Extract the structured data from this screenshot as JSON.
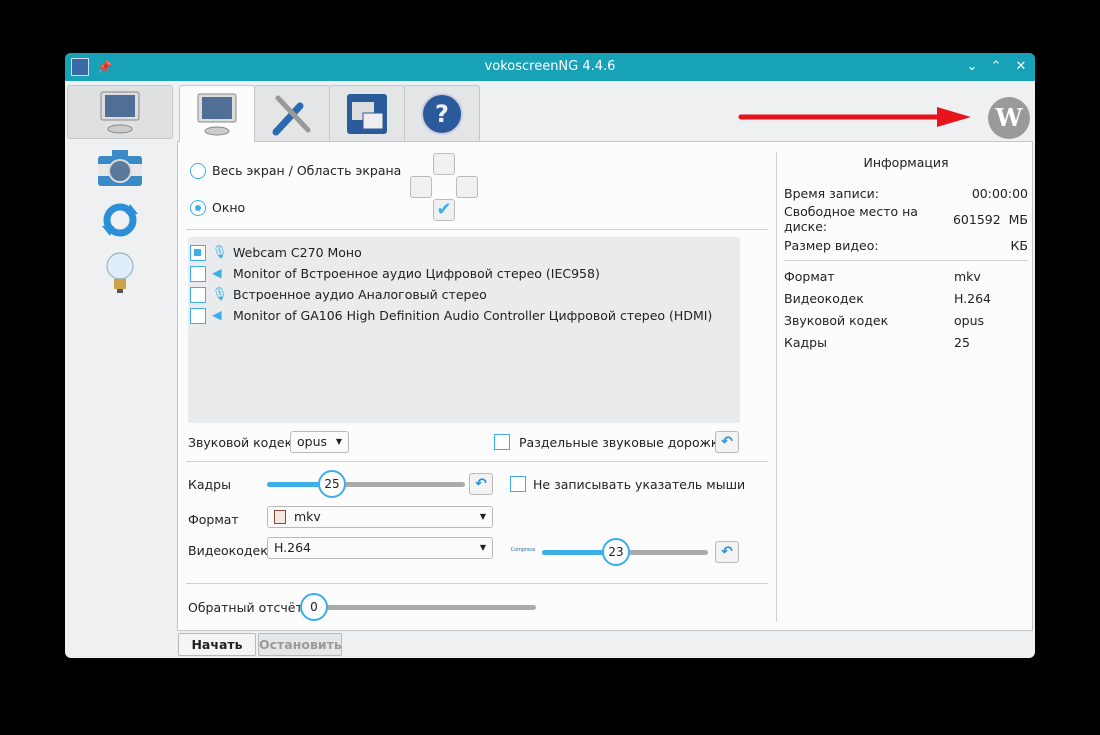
{
  "window": {
    "title": "vokoscreenNG 4.4.6"
  },
  "screen": {
    "mode_fullscreen": "Весь экран / Область экрана",
    "mode_window": "Окно",
    "selected_mode": "window",
    "audio_devices": [
      {
        "label": "Webcam C270 Моно",
        "type": "microphone",
        "checked": true
      },
      {
        "label": "Monitor of Встроенное аудио Цифровой стерео (IEC958)",
        "type": "speaker",
        "checked": false
      },
      {
        "label": "Встроенное аудио Аналоговый стерео",
        "type": "microphone",
        "checked": false
      },
      {
        "label": "Monitor of GA106 High Definition Audio Controller Цифровой стерео (HDMI)",
        "type": "speaker",
        "checked": false
      }
    ],
    "audio_codec_label": "Звуковой кодек",
    "audio_codec_value": "opus",
    "separate_tracks_label": "Раздельные звуковые дорожки",
    "frames_label": "Кадры",
    "frames_value": "25",
    "frames_fraction": 0.33,
    "no_cursor_label": "Не записывать указатель мыши",
    "format_label": "Формат",
    "format_value": "mkv",
    "videocodec_label": "Видеокодек",
    "videocodec_value": "H.264",
    "compress_icon_text": "Compress",
    "quality_value": "23",
    "quality_fraction": 0.45,
    "countdown_label": "Обратный отсчёт",
    "countdown_value": "0"
  },
  "info": {
    "title": "Информация",
    "rows1": [
      [
        "Время записи:",
        "00:00:00"
      ],
      [
        "Свободное место на диске:",
        "601592  МБ"
      ],
      [
        "Размер видео:",
        "КБ"
      ]
    ],
    "rows2": [
      [
        "Формат",
        "mkv"
      ],
      [
        "Видеокодек",
        "H.264"
      ],
      [
        "Звуковой кодек",
        "opus"
      ],
      [
        "Кадры",
        "25"
      ]
    ]
  },
  "buttons": {
    "start": "Начать",
    "stop": "Остановить"
  },
  "colors": {
    "titlebar": "#17a2b8",
    "accent": "#3daee9",
    "arrow": "#e8141b"
  }
}
